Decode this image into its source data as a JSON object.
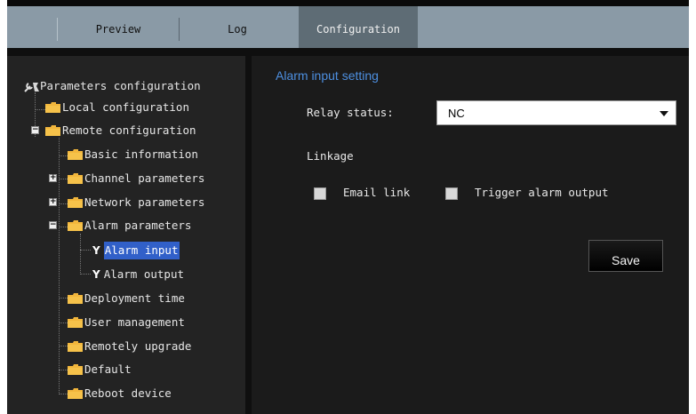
{
  "tabs": [
    {
      "label": "Preview"
    },
    {
      "label": "Log"
    },
    {
      "label": "Configuration",
      "active": true
    }
  ],
  "tree": {
    "root": "Parameters configuration",
    "items": [
      {
        "label": "Local configuration"
      },
      {
        "label": "Remote configuration",
        "expanded": true
      },
      {
        "label": "Basic information"
      },
      {
        "label": "Channel parameters",
        "expanded": false
      },
      {
        "label": "Network parameters",
        "expanded": false
      },
      {
        "label": "Alarm parameters",
        "expanded": true
      },
      {
        "label": "Alarm input",
        "selected": true
      },
      {
        "label": "Alarm output"
      },
      {
        "label": "Deployment time"
      },
      {
        "label": "User management"
      },
      {
        "label": "Remotely upgrade"
      },
      {
        "label": "Default"
      },
      {
        "label": "Reboot device"
      }
    ]
  },
  "form": {
    "section_title": "Alarm input setting",
    "relay_label": "Relay status:",
    "relay_value": "NC",
    "linkage_label": "Linkage",
    "email_link_label": "Email link",
    "email_link_checked": false,
    "trigger_alarm_label": "Trigger alarm output",
    "trigger_alarm_checked": false,
    "save_label": "Save"
  },
  "colors": {
    "tab_bar": "#8a9aa6",
    "tab_active": "#5e6c75",
    "section_title": "#4d8fe0",
    "selection": "#3160c9",
    "folder": "#f2b63c"
  }
}
